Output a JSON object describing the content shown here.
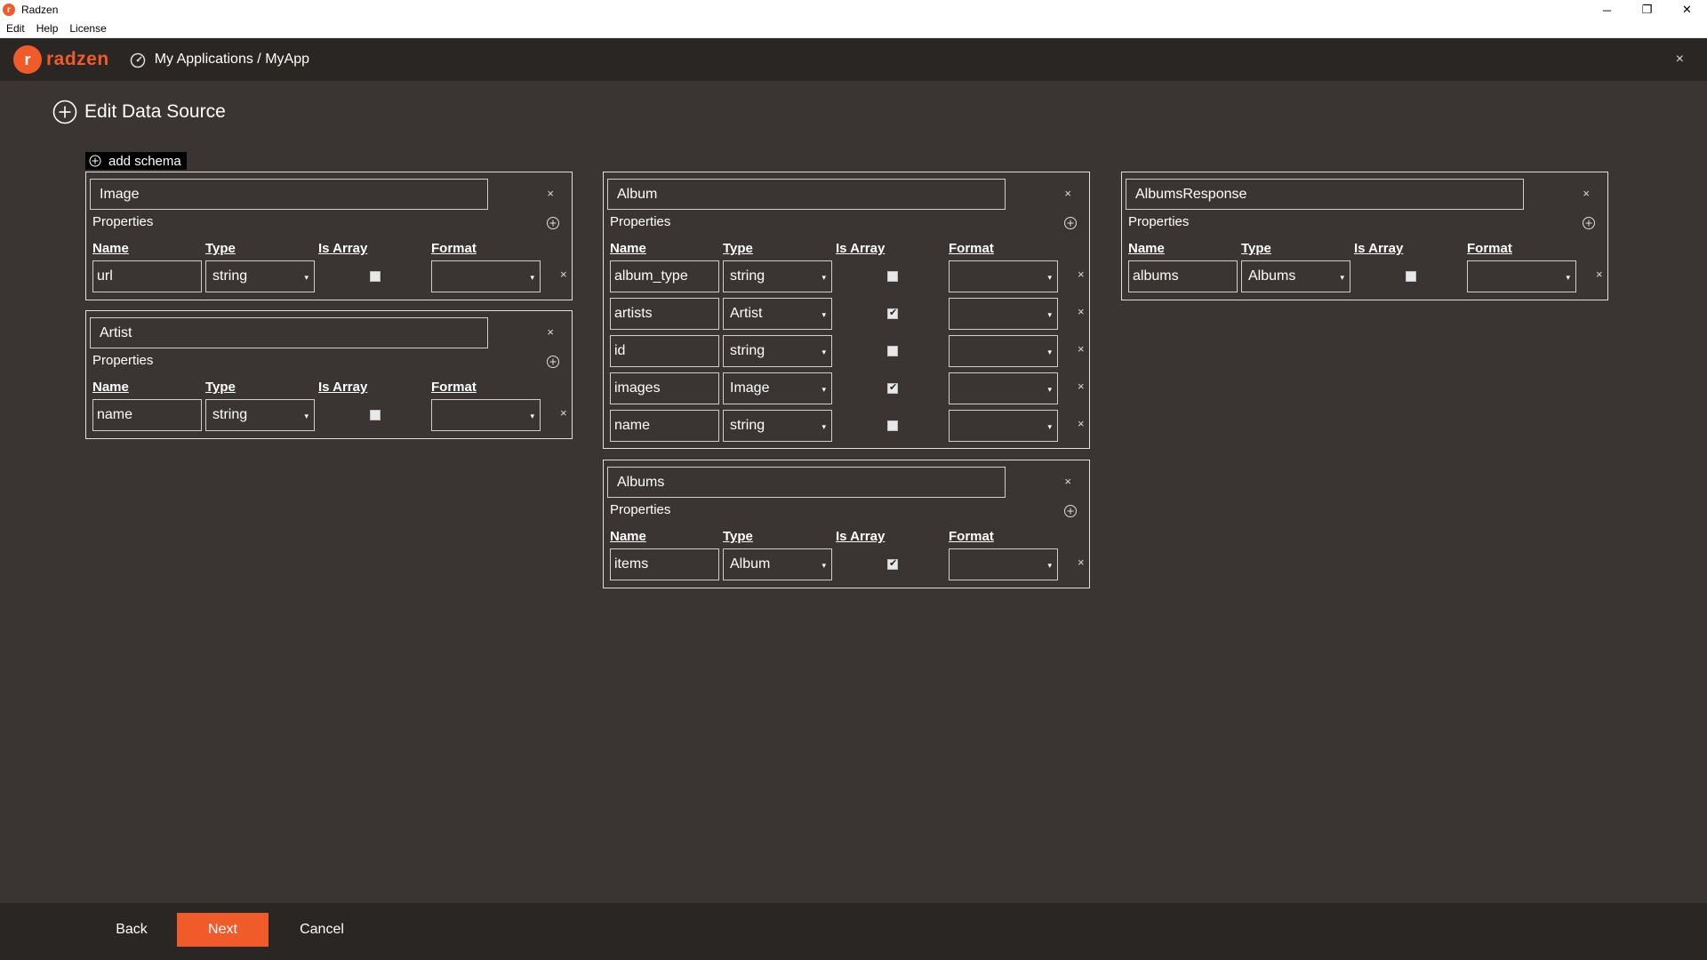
{
  "window": {
    "title": "Radzen",
    "minimize": "─",
    "restore": "❐",
    "close": "✕"
  },
  "menu": [
    {
      "label": "Edit"
    },
    {
      "label": "Help"
    },
    {
      "label": "License"
    }
  ],
  "header": {
    "logo_text": "radzen",
    "breadcrumb": "My Applications / MyApp",
    "close": "×"
  },
  "page": {
    "title": "Edit Data Source",
    "add_schema_label": "add schema"
  },
  "labels": {
    "properties": "Properties",
    "col_name": "Name",
    "col_type": "Type",
    "col_is_array": "Is Array",
    "col_format": "Format",
    "close": "×",
    "caret": "▾"
  },
  "schemas": [
    {
      "name": "Image",
      "properties": [
        {
          "name": "url",
          "type": "string",
          "is_array": false,
          "format": ""
        }
      ]
    },
    {
      "name": "Artist",
      "properties": [
        {
          "name": "name",
          "type": "string",
          "is_array": false,
          "format": ""
        }
      ]
    },
    {
      "name": "Album",
      "properties": [
        {
          "name": "album_type",
          "type": "string",
          "is_array": false,
          "format": ""
        },
        {
          "name": "artists",
          "type": "Artist",
          "is_array": true,
          "format": ""
        },
        {
          "name": "id",
          "type": "string",
          "is_array": false,
          "format": ""
        },
        {
          "name": "images",
          "type": "Image",
          "is_array": true,
          "format": ""
        },
        {
          "name": "name",
          "type": "string",
          "is_array": false,
          "format": ""
        }
      ]
    },
    {
      "name": "Albums",
      "properties": [
        {
          "name": "items",
          "type": "Album",
          "is_array": true,
          "format": ""
        }
      ]
    },
    {
      "name": "AlbumsResponse",
      "properties": [
        {
          "name": "albums",
          "type": "Albums",
          "is_array": false,
          "format": ""
        }
      ]
    }
  ],
  "footer": {
    "back": "Back",
    "next": "Next",
    "cancel": "Cancel"
  },
  "colors": {
    "accent": "#f15a29",
    "background": "#3a3532",
    "header": "#2a2624"
  }
}
